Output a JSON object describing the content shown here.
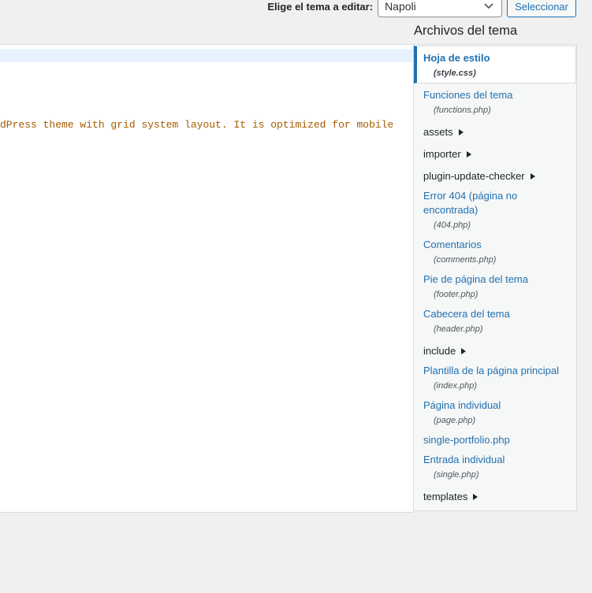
{
  "theme_selector": {
    "label": "Elige el tema a editar:",
    "selected": "Napoli",
    "button": "Seleccionar"
  },
  "editor": {
    "lines": [
      "dPress theme with grid system layout. It is optimized for mobile"
    ],
    "text_color": "#a55a00"
  },
  "files": {
    "title": "Archivos del tema",
    "items": [
      {
        "kind": "file",
        "label": "Hoja de estilo",
        "file": "(style.css)",
        "active": true
      },
      {
        "kind": "file",
        "label": "Funciones del tema",
        "file": "(functions.php)"
      },
      {
        "kind": "folder",
        "label": "assets"
      },
      {
        "kind": "folder",
        "label": "importer"
      },
      {
        "kind": "folder",
        "label": "plugin-update-checker"
      },
      {
        "kind": "file",
        "label": "Error 404 (página no encontrada)",
        "file": "(404.php)"
      },
      {
        "kind": "file",
        "label": "Comentarios",
        "file": "(comments.php)"
      },
      {
        "kind": "file",
        "label": "Pie de página del tema",
        "file": "(footer.php)"
      },
      {
        "kind": "file",
        "label": "Cabecera del tema",
        "file": "(header.php)"
      },
      {
        "kind": "folder",
        "label": "include"
      },
      {
        "kind": "file",
        "label": "Plantilla de la página principal",
        "file": "(index.php)"
      },
      {
        "kind": "file",
        "label": "Página individual",
        "file": "(page.php)"
      },
      {
        "kind": "file",
        "label": "single-portfolio.php",
        "file": ""
      },
      {
        "kind": "file",
        "label": "Entrada individual",
        "file": "(single.php)"
      },
      {
        "kind": "folder",
        "label": "templates"
      }
    ]
  },
  "colors": {
    "link": "#2271b1",
    "accent": "#2271b1",
    "background": "#f0f0f1"
  }
}
